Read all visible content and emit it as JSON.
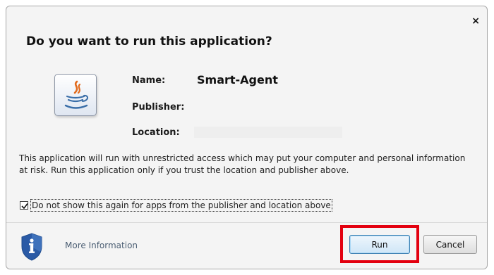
{
  "dialog": {
    "title": "Do you want to run this application?",
    "close_glyph": "×"
  },
  "app": {
    "icon": "java-coffee-cup-icon",
    "name_label": "Name:",
    "name_value": "Smart-Agent",
    "publisher_label": "Publisher:",
    "publisher_value": "",
    "location_label": "Location:",
    "location_value": ""
  },
  "warning_text": "This application will run with unrestricted access which may put your computer and personal information at risk. Run this application only if you trust the location and publisher above.",
  "dont_show_again": {
    "checked": true,
    "label": "Do not show this again for apps from the publisher and location above"
  },
  "footer": {
    "info_icon": "shield-info-icon",
    "more_info_label": "More Information",
    "run_label": "Run",
    "cancel_label": "Cancel"
  },
  "colors": {
    "highlight_border": "#e3000f",
    "shield_blue": "#2a5aa6",
    "link_text": "#4b5e73"
  }
}
